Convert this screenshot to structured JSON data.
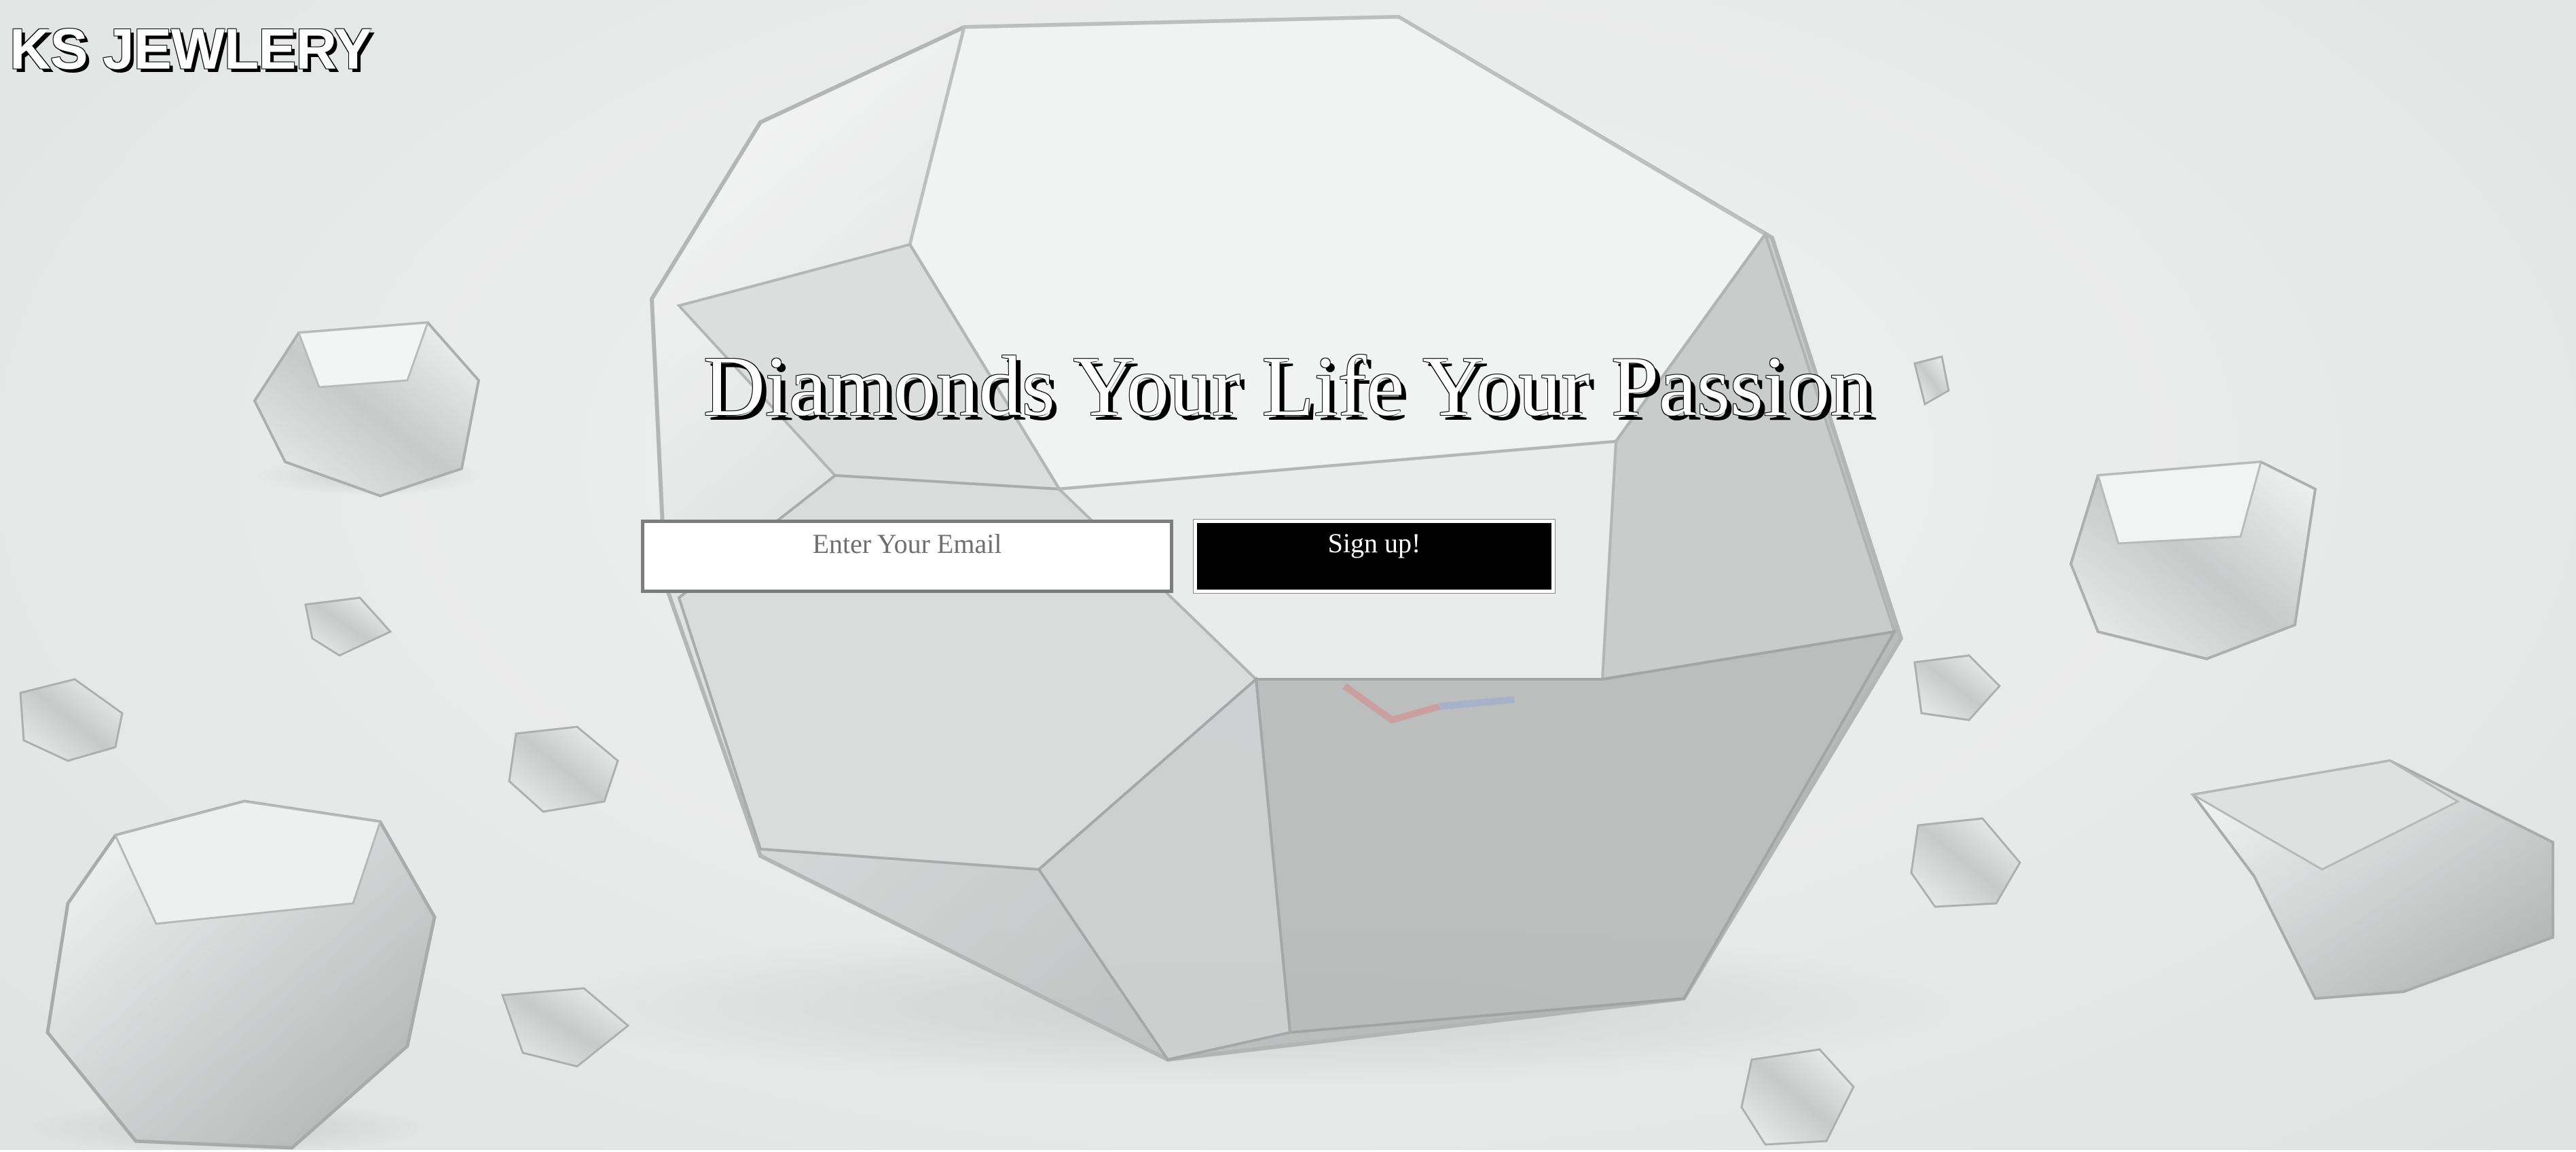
{
  "header": {
    "logo_text": "KS JEWLERY"
  },
  "hero": {
    "background_image": "diamonds-photo",
    "headline": "Diamonds Your Life Your Passion"
  },
  "signup": {
    "email_placeholder": "Enter Your Email",
    "email_value": "",
    "button_label": "Sign up!"
  },
  "colors": {
    "button_background": "#000000",
    "button_text": "#ffffff",
    "headline_text": "#ffffff",
    "headline_shadow": "#000000",
    "input_border": "#7d7d7d",
    "page_background": "#e2e4e4"
  }
}
